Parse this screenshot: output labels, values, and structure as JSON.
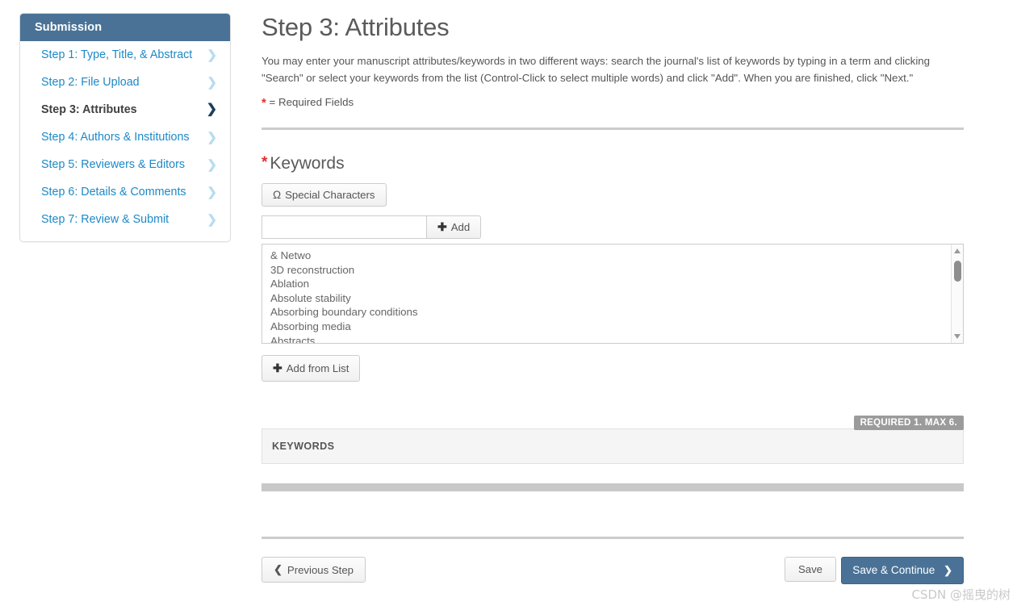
{
  "sidebar": {
    "header": "Submission",
    "items": [
      {
        "label": "Step 1: Type, Title, & Abstract",
        "active": false
      },
      {
        "label": "Step 2: File Upload",
        "active": false
      },
      {
        "label": "Step 3: Attributes",
        "active": true
      },
      {
        "label": "Step 4: Authors & Institutions",
        "active": false
      },
      {
        "label": "Step 5: Reviewers & Editors",
        "active": false
      },
      {
        "label": "Step 6: Details & Comments",
        "active": false
      },
      {
        "label": "Step 7: Review & Submit",
        "active": false
      }
    ],
    "chevron_glyph": "❯",
    "header_color": "#4a7296",
    "link_color": "#1c89c7"
  },
  "main": {
    "title": "Step 3: Attributes",
    "intro": "You may enter your manuscript attributes/keywords in two different ways: search the journal's list of keywords by typing in a term and clicking \"Search\" or select your keywords from the list (Control-Click to select multiple words) and click \"Add\". When you are finished, click \"Next.\"",
    "required_star": "*",
    "required_note": "= Required Fields",
    "required_star_color": "#e03030"
  },
  "keywords_section": {
    "heading": "Keywords",
    "heading_star": "*",
    "special_characters_button": "Special Characters",
    "special_characters_icon": "Ω",
    "input_value": "",
    "input_placeholder": "",
    "add_button": "Add",
    "add_icon": "➕",
    "list_items": [
      "& Netwo",
      "3D reconstruction",
      "Ablation",
      "Absolute stability",
      "Absorbing boundary conditions",
      "Absorbing media",
      "Abstracts"
    ],
    "add_from_list_button": "Add from List",
    "scrollbar": {
      "up_arrow_icon": "scroll-up-arrow",
      "down_arrow_icon": "scroll-down-arrow",
      "thumb_icon": "scroll-thumb"
    }
  },
  "keywords_table": {
    "required_badge": "REQUIRED 1. MAX 6.",
    "badge_color": "#9b9b9b",
    "column_header": "KEYWORDS",
    "rows": []
  },
  "footer": {
    "previous_step": "Previous Step",
    "previous_icon": "❮",
    "save": "Save",
    "save_continue": "Save & Continue",
    "save_continue_icon": "❯",
    "primary_color": "#4a7296"
  },
  "watermark": {
    "text": "CSDN @摇曳的树"
  }
}
